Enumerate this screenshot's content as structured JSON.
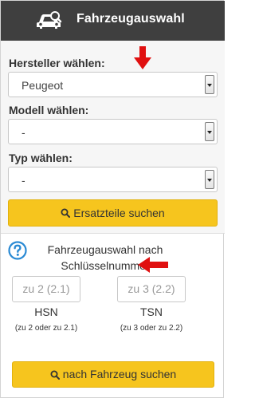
{
  "header": {
    "title": "Fahrzeugauswahl",
    "icon": "car-search-icon"
  },
  "manufacturer": {
    "label": "Hersteller wählen:",
    "value": "Peugeot"
  },
  "model": {
    "label": "Modell wählen:",
    "value": "-"
  },
  "type": {
    "label": "Typ wählen:",
    "value": "-"
  },
  "spare_parts_button": {
    "label": "Ersatzteile suchen"
  },
  "kba": {
    "title": "Fahrzeugauswahl nach Schlüsselnummer",
    "hsn": {
      "placeholder": "zu 2 (2.1)",
      "caption": "HSN",
      "hint": "(zu 2 oder zu 2.1)"
    },
    "tsn": {
      "placeholder": "zu 3 (2.2)",
      "caption": "TSN",
      "hint": "(zu 3 oder zu 2.2)"
    }
  },
  "vehicle_search_button": {
    "label": "nach Fahrzeug suchen"
  },
  "colors": {
    "header_bg": "#3f3f3f",
    "accent_yellow": "#f6c51e",
    "annotation_red": "#e01010",
    "help_blue": "#2a8ad4"
  }
}
